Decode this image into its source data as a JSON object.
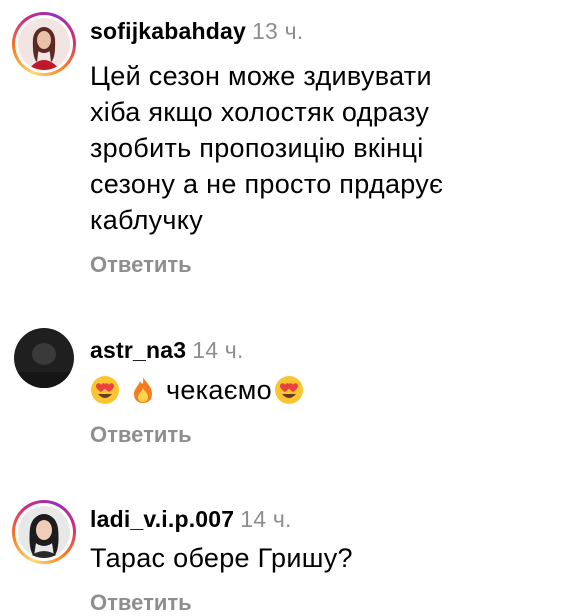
{
  "comments": [
    {
      "username": "sofijkabahday",
      "time": "13 ч.",
      "lines": [
        "Цей сезон може здивувати",
        "хіба якщо холостяк  одразу",
        "зробить пропозицію вкінці",
        "сезону а не просто прдарує",
        "каблучку"
      ],
      "reply_label": "Ответить",
      "avatar_icon": "profile-photo-woman-red",
      "story_ring": true
    },
    {
      "username": "astr_na3",
      "time": "14 ч.",
      "emojis_before": [
        "heart-eyes-emoji",
        "fire-emoji"
      ],
      "text": "чекаємо",
      "emojis_after": [
        "heart-eyes-emoji"
      ],
      "reply_label": "Ответить",
      "avatar_icon": "profile-photo-dark",
      "story_ring": false
    },
    {
      "username": "ladi_v.i.p.007",
      "time": "14 ч.",
      "text": "Тарас обере Гришу?",
      "reply_label": "Ответить",
      "avatar_icon": "profile-photo-woman-dark-hair",
      "story_ring": true
    }
  ],
  "colors": {
    "secondary_text": "#8e8e8e",
    "primary_text": "#000000",
    "background": "#ffffff"
  }
}
